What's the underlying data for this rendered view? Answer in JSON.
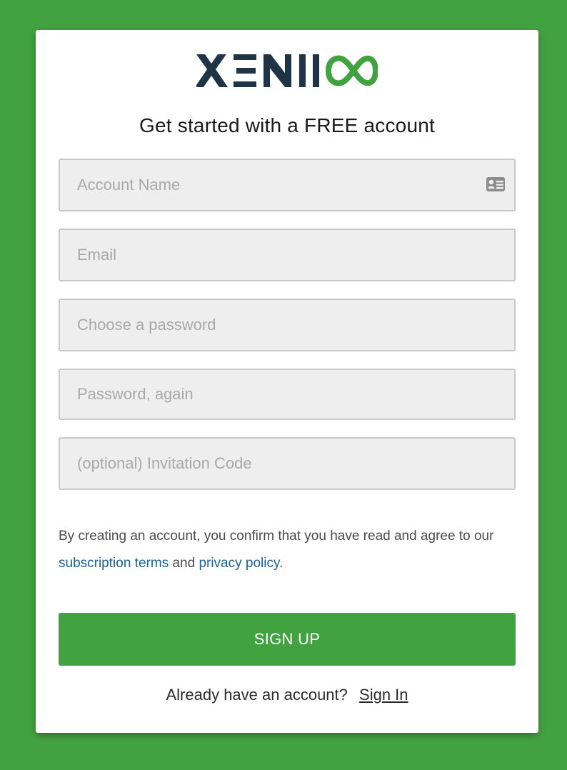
{
  "colors": {
    "background": "#43a240",
    "brand_dark": "#1f3447",
    "brand_green": "#43a240",
    "link": "#1c6096",
    "field_bg": "#eeeeee"
  },
  "logo": {
    "text": "XENIOO",
    "icon": "infinity-icon"
  },
  "headline": "Get started with a FREE account",
  "form": {
    "account_name": {
      "placeholder": "Account Name",
      "value": "",
      "icon": "id-card-icon"
    },
    "email": {
      "placeholder": "Email",
      "value": ""
    },
    "password": {
      "placeholder": "Choose a password",
      "value": ""
    },
    "password_again": {
      "placeholder": "Password, again",
      "value": ""
    },
    "invitation_code": {
      "placeholder": "(optional) Invitation Code",
      "value": ""
    }
  },
  "terms": {
    "prefix": "By creating an account, you confirm that you have read and agree to our ",
    "subscription_link": "subscription terms",
    "middle": " and ",
    "privacy_link": "privacy policy",
    "suffix": "."
  },
  "signup_button": "SIGN UP",
  "signin": {
    "prompt": "Already have an account?",
    "link": "Sign In"
  }
}
